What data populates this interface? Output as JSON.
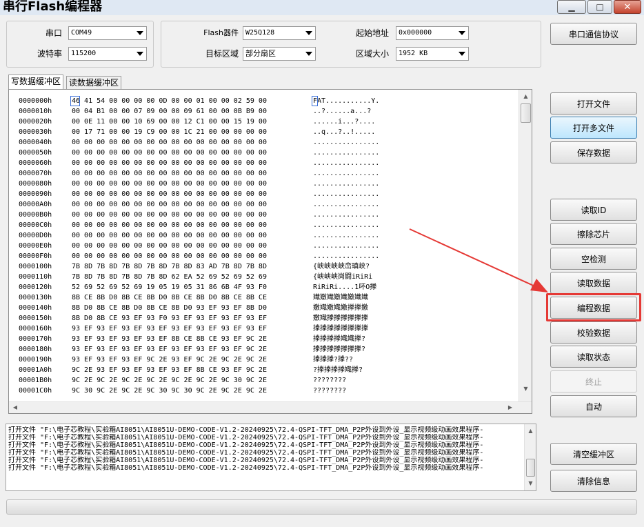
{
  "window": {
    "title": "串行Flash编程器",
    "minimize": "▁",
    "restore": "□",
    "close": "✕"
  },
  "settings": {
    "port_label": "串口",
    "port_value": "COM49",
    "baud_label": "波特率",
    "baud_value": "115200",
    "device_label": "Flash器件",
    "device_value": "W25Q128",
    "region_label": "目标区域",
    "region_value": "部分扇区",
    "start_label": "起始地址",
    "start_value": "0x000000",
    "size_label": "区域大小",
    "size_value": "1952 KB"
  },
  "buttons": {
    "protocol": "串口通信协议",
    "open_file": "打开文件",
    "open_multi": "打开多文件",
    "save_data": "保存数据",
    "read_id": "读取ID",
    "erase_chip": "擦除芯片",
    "blank_check": "空检测",
    "read_data": "读取数据",
    "program_data": "编程数据",
    "verify_data": "校验数据",
    "read_status": "读取状态",
    "stop": "终止",
    "auto": "自动",
    "clear_buffer": "清空缓冲区",
    "clear_info": "清除信息"
  },
  "tabs": {
    "write": "写数据缓冲区",
    "read": "读数据缓冲区"
  },
  "hex_rows": [
    {
      "addr": "0000000h",
      "hex": "46 41 54 00 00 00 00 0D 00 00 01 00 00 02 59 00",
      "ascii": "FAT...........Y."
    },
    {
      "addr": "0000010h",
      "hex": "00 04 B1 00 00 07 09 00 00 09 61 00 00 0B B9 00",
      "ascii": "..?......a...?"
    },
    {
      "addr": "0000020h",
      "hex": "00 0E 11 00 00 10 69 00 00 12 C1 00 00 15 19 00",
      "ascii": "......i...?...."
    },
    {
      "addr": "0000030h",
      "hex": "00 17 71 00 00 19 C9 00 00 1C 21 00 00 00 00 00",
      "ascii": "..q...?..!....."
    },
    {
      "addr": "0000040h",
      "hex": "00 00 00 00 00 00 00 00 00 00 00 00 00 00 00 00",
      "ascii": "................"
    },
    {
      "addr": "0000050h",
      "hex": "00 00 00 00 00 00 00 00 00 00 00 00 00 00 00 00",
      "ascii": "................"
    },
    {
      "addr": "0000060h",
      "hex": "00 00 00 00 00 00 00 00 00 00 00 00 00 00 00 00",
      "ascii": "................"
    },
    {
      "addr": "0000070h",
      "hex": "00 00 00 00 00 00 00 00 00 00 00 00 00 00 00 00",
      "ascii": "................"
    },
    {
      "addr": "0000080h",
      "hex": "00 00 00 00 00 00 00 00 00 00 00 00 00 00 00 00",
      "ascii": "................"
    },
    {
      "addr": "0000090h",
      "hex": "00 00 00 00 00 00 00 00 00 00 00 00 00 00 00 00",
      "ascii": "................"
    },
    {
      "addr": "00000A0h",
      "hex": "00 00 00 00 00 00 00 00 00 00 00 00 00 00 00 00",
      "ascii": "................"
    },
    {
      "addr": "00000B0h",
      "hex": "00 00 00 00 00 00 00 00 00 00 00 00 00 00 00 00",
      "ascii": "................"
    },
    {
      "addr": "00000C0h",
      "hex": "00 00 00 00 00 00 00 00 00 00 00 00 00 00 00 00",
      "ascii": "................"
    },
    {
      "addr": "00000D0h",
      "hex": "00 00 00 00 00 00 00 00 00 00 00 00 00 00 00 00",
      "ascii": "................"
    },
    {
      "addr": "00000E0h",
      "hex": "00 00 00 00 00 00 00 00 00 00 00 00 00 00 00 00",
      "ascii": "................"
    },
    {
      "addr": "00000F0h",
      "hex": "00 00 00 00 00 00 00 00 00 00 00 00 00 00 00 00",
      "ascii": "................"
    },
    {
      "addr": "0000100h",
      "hex": "7B 8D 7B 8D 7B 8D 7B 8D 7B 8D 83 AD 7B 8D 7B 8D",
      "ascii": "{峡峡峡峡峦瑱峡?"
    },
    {
      "addr": "0000110h",
      "hex": "7B 8D 7B 8D 7B 8D 7B 8D 62 EA 52 69 52 69 52 69",
      "ascii": "{峡峡峡岗闘iRiRi"
    },
    {
      "addr": "0000120h",
      "hex": "52 69 52 69 52 69 19 05 19 05 31 86 6B 4F 93 F0",
      "ascii": "RiRiRi....1吥O搼"
    },
    {
      "addr": "0000130h",
      "hex": "8B CE 8B D0 8B CE 8B D0 8B CE 8B D0 8B CE 8B CE",
      "ascii": "嬂嬓嬂嬓嬂嬓嬂嬂"
    },
    {
      "addr": "0000140h",
      "hex": "8B D0 8B CE 8B D0 8B CE 8B D0 93 EF 93 EF 8B D0",
      "ascii": "嬓嬂嬓嬂嬓搼搼嬓"
    },
    {
      "addr": "0000150h",
      "hex": "8B D0 8B CE 93 EF 93 F0 93 EF 93 EF 93 EF 93 EF",
      "ascii": "嬓嬂搼搼搼搼搼搼"
    },
    {
      "addr": "0000160h",
      "hex": "93 EF 93 EF 93 EF 93 EF 93 EF 93 EF 93 EF 93 EF",
      "ascii": "搼搼搼搼搼搼搼搼"
    },
    {
      "addr": "0000170h",
      "hex": "93 EF 93 EF 93 EF 93 EF 8B CE 8B CE 93 EF 9C 2E",
      "ascii": "搼搼搼搼嬂嬂搼?"
    },
    {
      "addr": "0000180h",
      "hex": "93 EF 93 EF 93 EF 93 EF 93 EF 93 EF 93 EF 9C 2E",
      "ascii": "搼搼搼搼搼搼搼?"
    },
    {
      "addr": "0000190h",
      "hex": "93 EF 93 EF 93 EF 9C 2E 93 EF 9C 2E 9C 2E 9C 2E",
      "ascii": "搼搼搼?搼??"
    },
    {
      "addr": "00001A0h",
      "hex": "9C 2E 93 EF 93 EF 93 EF 93 EF 8B CE 93 EF 9C 2E",
      "ascii": "?搼搼搼搼嬂搼?"
    },
    {
      "addr": "00001B0h",
      "hex": "9C 2E 9C 2E 9C 2E 9C 2E 9C 2E 9C 2E 9C 30 9C 2E",
      "ascii": "????????"
    },
    {
      "addr": "00001C0h",
      "hex": "9C 30 9C 2E 9C 2E 9C 30 9C 30 9C 2E 9C 2E 9C 2E",
      "ascii": "????????"
    }
  ],
  "log_lines": [
    "打开文件 \"F:\\电子芯教程\\实验箱AI8051\\AI8051U-DEMO-CODE-V1.2-20240925\\72.4-QSPI-TFT_DMA_P2P外设到外设_显示视频级动画效果程序-",
    "打开文件 \"F:\\电子芯教程\\实验箱AI8051\\AI8051U-DEMO-CODE-V1.2-20240925\\72.4-QSPI-TFT_DMA_P2P外设到外设_显示视频级动画效果程序-",
    "打开文件 \"F:\\电子芯教程\\实验箱AI8051\\AI8051U-DEMO-CODE-V1.2-20240925\\72.4-QSPI-TFT_DMA_P2P外设到外设_显示视频级动画效果程序-",
    "打开文件 \"F:\\电子芯教程\\实验箱AI8051\\AI8051U-DEMO-CODE-V1.2-20240925\\72.4-QSPI-TFT_DMA_P2P外设到外设_显示视频级动画效果程序-",
    "打开文件 \"F:\\电子芯教程\\实验箱AI8051\\AI8051U-DEMO-CODE-V1.2-20240925\\72.4-QSPI-TFT_DMA_P2P外设到外设_显示视频级动画效果程序-",
    "打开文件 \"F:\\电子芯教程\\实验箱AI8051\\AI8051U-DEMO-CODE-V1.2-20240925\\72.4-QSPI-TFT_DMA_P2P外设到外设_显示视频级动画效果程序-"
  ],
  "annotation": {
    "color": "#e53935"
  }
}
